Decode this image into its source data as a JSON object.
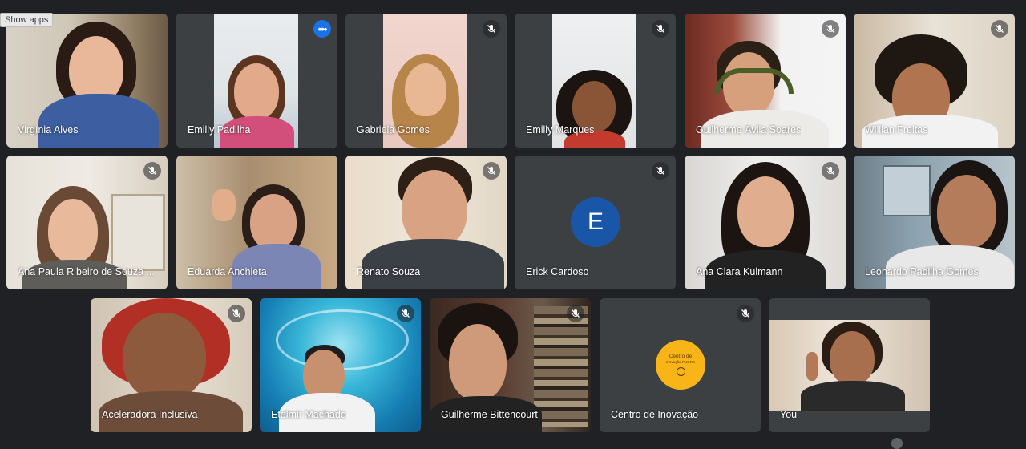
{
  "topbar": {
    "show_apps": "Show apps"
  },
  "participants": [
    {
      "name": "Virgínia Alves",
      "muted": false
    },
    {
      "name": "Emilly Padilha",
      "muted": false,
      "speaking": true
    },
    {
      "name": "Gabriela Gomes",
      "muted": true
    },
    {
      "name": "Emilly Marques",
      "muted": true
    },
    {
      "name": "Guilherme Ávila Soares",
      "muted": true
    },
    {
      "name": "Willian Freitas",
      "muted": true
    },
    {
      "name": "Ana Paula Ribeiro de Souza ...",
      "muted": true
    },
    {
      "name": "Eduarda Anchieta",
      "muted": false
    },
    {
      "name": "Renato Souza",
      "muted": true
    },
    {
      "name": "Erick Cardoso",
      "muted": true,
      "avatar_letter": "E",
      "avatar_color": "#1a56a8"
    },
    {
      "name": "Ana Clara Kulmann",
      "muted": true
    },
    {
      "name": "Leonardo Padilha Gomes",
      "muted": false
    },
    {
      "name": "Aceleradora Inclusiva",
      "muted": true
    },
    {
      "name": "Etelmir Machado",
      "muted": true
    },
    {
      "name": "Guilherme Bittencourt",
      "muted": true
    },
    {
      "name": "Centro de Inovação",
      "muted": true,
      "logo_line1": "Centro de",
      "logo_line2": "Inovação PUCRS",
      "logo_color": "#f9b418"
    },
    {
      "name": "You",
      "muted": false
    }
  ],
  "colors": {
    "background": "#202124",
    "tile": "#3c4043",
    "active_border": "#8ab4f8",
    "accent": "#1a73e8"
  }
}
